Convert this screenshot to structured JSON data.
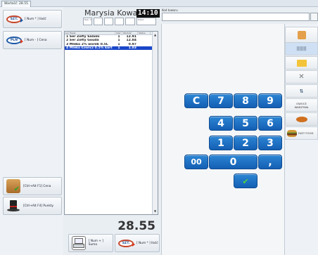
{
  "window": {
    "tab_title": "Wartość: 28.55"
  },
  "left_panel": {
    "buttons": [
      {
        "icon": "szt-arrow-icon",
        "icon_text": "SZT.",
        "label": "[ Num * ] Ilość"
      },
      {
        "icon": "pln-arrow-icon",
        "icon_text": "PLN",
        "label": "[ Num - ] Cena"
      },
      {
        "icon": "crate-check-icon",
        "label": "[Ctrl+Alt F1] Cena"
      },
      {
        "icon": "top-hat-icon",
        "label": "[Ctrl+Alt F4] Punkty"
      }
    ]
  },
  "customer": {
    "name": "Marysia Kowalska",
    "time": "14:10",
    "box_label": "Rab. 0",
    "small_label": "Klient"
  },
  "receipt": {
    "columns": [
      "Lp",
      "Towar",
      "Ilość",
      "Wartość",
      "Status"
    ],
    "rows": [
      {
        "name": "1 Ser Żółty Salami",
        "qty": "1",
        "value": "12.91",
        "selected": false
      },
      {
        "name": "2 Ser Żółty Gouda",
        "qty": "1",
        "value": "12.84",
        "selected": false
      },
      {
        "name": "3 Mleko 2% worek 0.5L",
        "qty": "1",
        "value": "0.97",
        "selected": false
      },
      {
        "name": "4 Mleko Łowicz 0.5% kart",
        "qty": "1",
        "value": "1.83",
        "selected": true
      }
    ],
    "total": "28.55"
  },
  "bottom_buttons": [
    {
      "icon": "printer-icon",
      "label": "[ Num + ] Suma"
    },
    {
      "icon": "szt-arrow-icon",
      "icon_text": "SZT.",
      "label": "[ Num * ] Ilość"
    }
  ],
  "search": {
    "label": "Kod towaru",
    "value": ""
  },
  "keypad": {
    "keys": [
      "C",
      "7",
      "8",
      "9",
      "4",
      "5",
      "6",
      "1",
      "2",
      "3",
      "00",
      "0",
      ","
    ]
  },
  "categories": [
    {
      "icon": "fruit-box-icon",
      "label": ""
    },
    {
      "icon": "barcode-icon",
      "label": ""
    },
    {
      "icon": "folder-icon",
      "label": ""
    },
    {
      "icon": "tools-icon",
      "label": ""
    },
    {
      "icon": "sort-icon",
      "label": ""
    },
    {
      "icon": "",
      "label": "OWOCE WARZYWA"
    },
    {
      "icon": "bread-icon",
      "label": ""
    },
    {
      "icon": "burger-icon",
      "label": "FAST FOOD"
    }
  ]
}
